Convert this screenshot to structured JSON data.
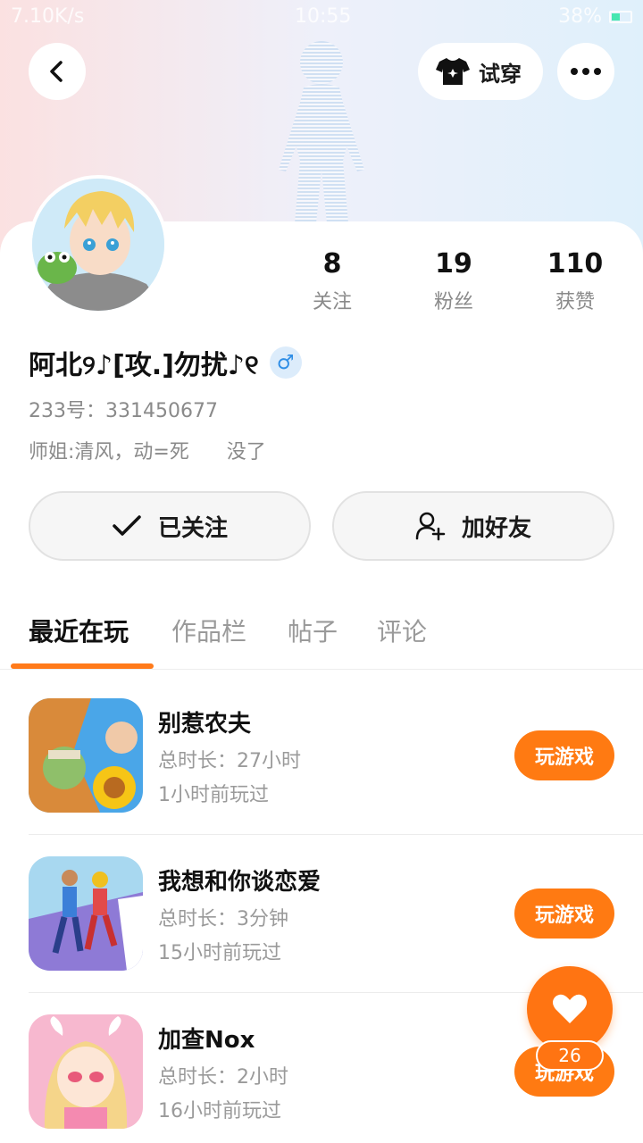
{
  "status_bar": {
    "network": "7.10K/s",
    "time": "10:55",
    "battery": "38%"
  },
  "header": {
    "tryon_label": "试穿"
  },
  "profile": {
    "name": "阿北୨♪[攻.]勿扰♪୧",
    "gender_symbol": "♂",
    "uid": "233号：331450677",
    "bio": "师姐:清风，动=死      没了"
  },
  "stats": [
    {
      "num": "8",
      "label": "关注"
    },
    {
      "num": "19",
      "label": "粉丝"
    },
    {
      "num": "110",
      "label": "获赞"
    }
  ],
  "actions": {
    "following_label": "已关注",
    "add_friend_label": "加好友"
  },
  "tabs": [
    {
      "label": "最近在玩",
      "active": true
    },
    {
      "label": "作品栏",
      "active": false
    },
    {
      "label": "帖子",
      "active": false
    },
    {
      "label": "评论",
      "active": false
    }
  ],
  "games": [
    {
      "title": "别惹农夫",
      "total": "总时长：27小时",
      "last": "1小时前玩过",
      "play": "玩游戏"
    },
    {
      "title": "我想和你谈恋爱",
      "total": "总时长：3分钟",
      "last": "15小时前玩过",
      "play": "玩游戏"
    },
    {
      "title": "加查Nox",
      "total": "总时长：2小时",
      "last": "16小时前玩过",
      "play": "玩游戏"
    }
  ],
  "fab": {
    "count": "26"
  },
  "colors": {
    "accent": "#ff7a12",
    "gender": "#2f8ee6",
    "muted": "#8a8a8a"
  }
}
